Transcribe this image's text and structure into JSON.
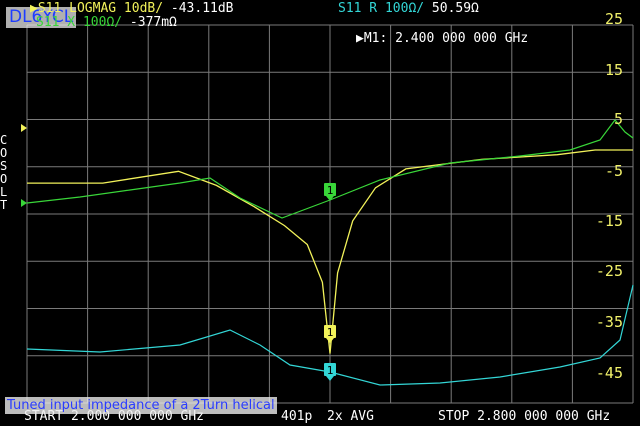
{
  "overlay": {
    "callsign": "DL6YCL",
    "caption": "Tuned input impedance of a 2Turn helical"
  },
  "header": {
    "trace1": {
      "marker": "▶",
      "label": "S11 LOGMAG 10dB/",
      "value": "-43.11dB",
      "color": "#f2f25a"
    },
    "trace2": {
      "label": "S11 X 100Ω/",
      "value": "-377mΩ",
      "color": "#39d639"
    },
    "trace3": {
      "label": "S11 R 100Ω/",
      "value": "50.59Ω",
      "color": "#33d6d6"
    },
    "marker_readout": "▶M1: 2.400 000 000 GHz"
  },
  "side_menu": [
    "C",
    "O",
    "S",
    "O",
    "L",
    "T"
  ],
  "y_axis_labels": [
    "25",
    "15",
    "5",
    "-5",
    "-15",
    "-25",
    "-35",
    "-45"
  ],
  "footer": {
    "start": "START 2.000 000 000 GHz",
    "points": "401p",
    "averaging": "2x AVG",
    "stop": "STOP 2.800 000 000 GHz"
  },
  "markers": [
    {
      "trace": "logmag",
      "label": "1"
    },
    {
      "trace": "reactance",
      "label": "1"
    },
    {
      "trace": "resistance",
      "label": "1"
    }
  ],
  "chart_data": {
    "type": "line",
    "x_range_ghz": [
      2.0,
      2.8
    ],
    "marker_frequency_ghz": 2.4,
    "series": [
      {
        "name": "S11 LOGMAG",
        "color": "#f2f25a",
        "x_ghz": [
          2.0,
          2.1,
          2.2,
          2.25,
          2.3,
          2.34,
          2.37,
          2.39,
          2.4,
          2.41,
          2.43,
          2.46,
          2.5,
          2.6,
          2.7,
          2.75,
          2.8
        ],
        "y_db": [
          -7,
          -7,
          -4.5,
          -7.5,
          -12,
          -16,
          -20,
          -28,
          -43.1,
          -26,
          -15,
          -8,
          -4,
          -2,
          -1,
          0,
          0
        ]
      },
      {
        "name": "S11 X 100Ω/",
        "color": "#39d639"
      },
      {
        "name": "S11 R 100Ω/",
        "color": "#33d6d6"
      }
    ]
  }
}
